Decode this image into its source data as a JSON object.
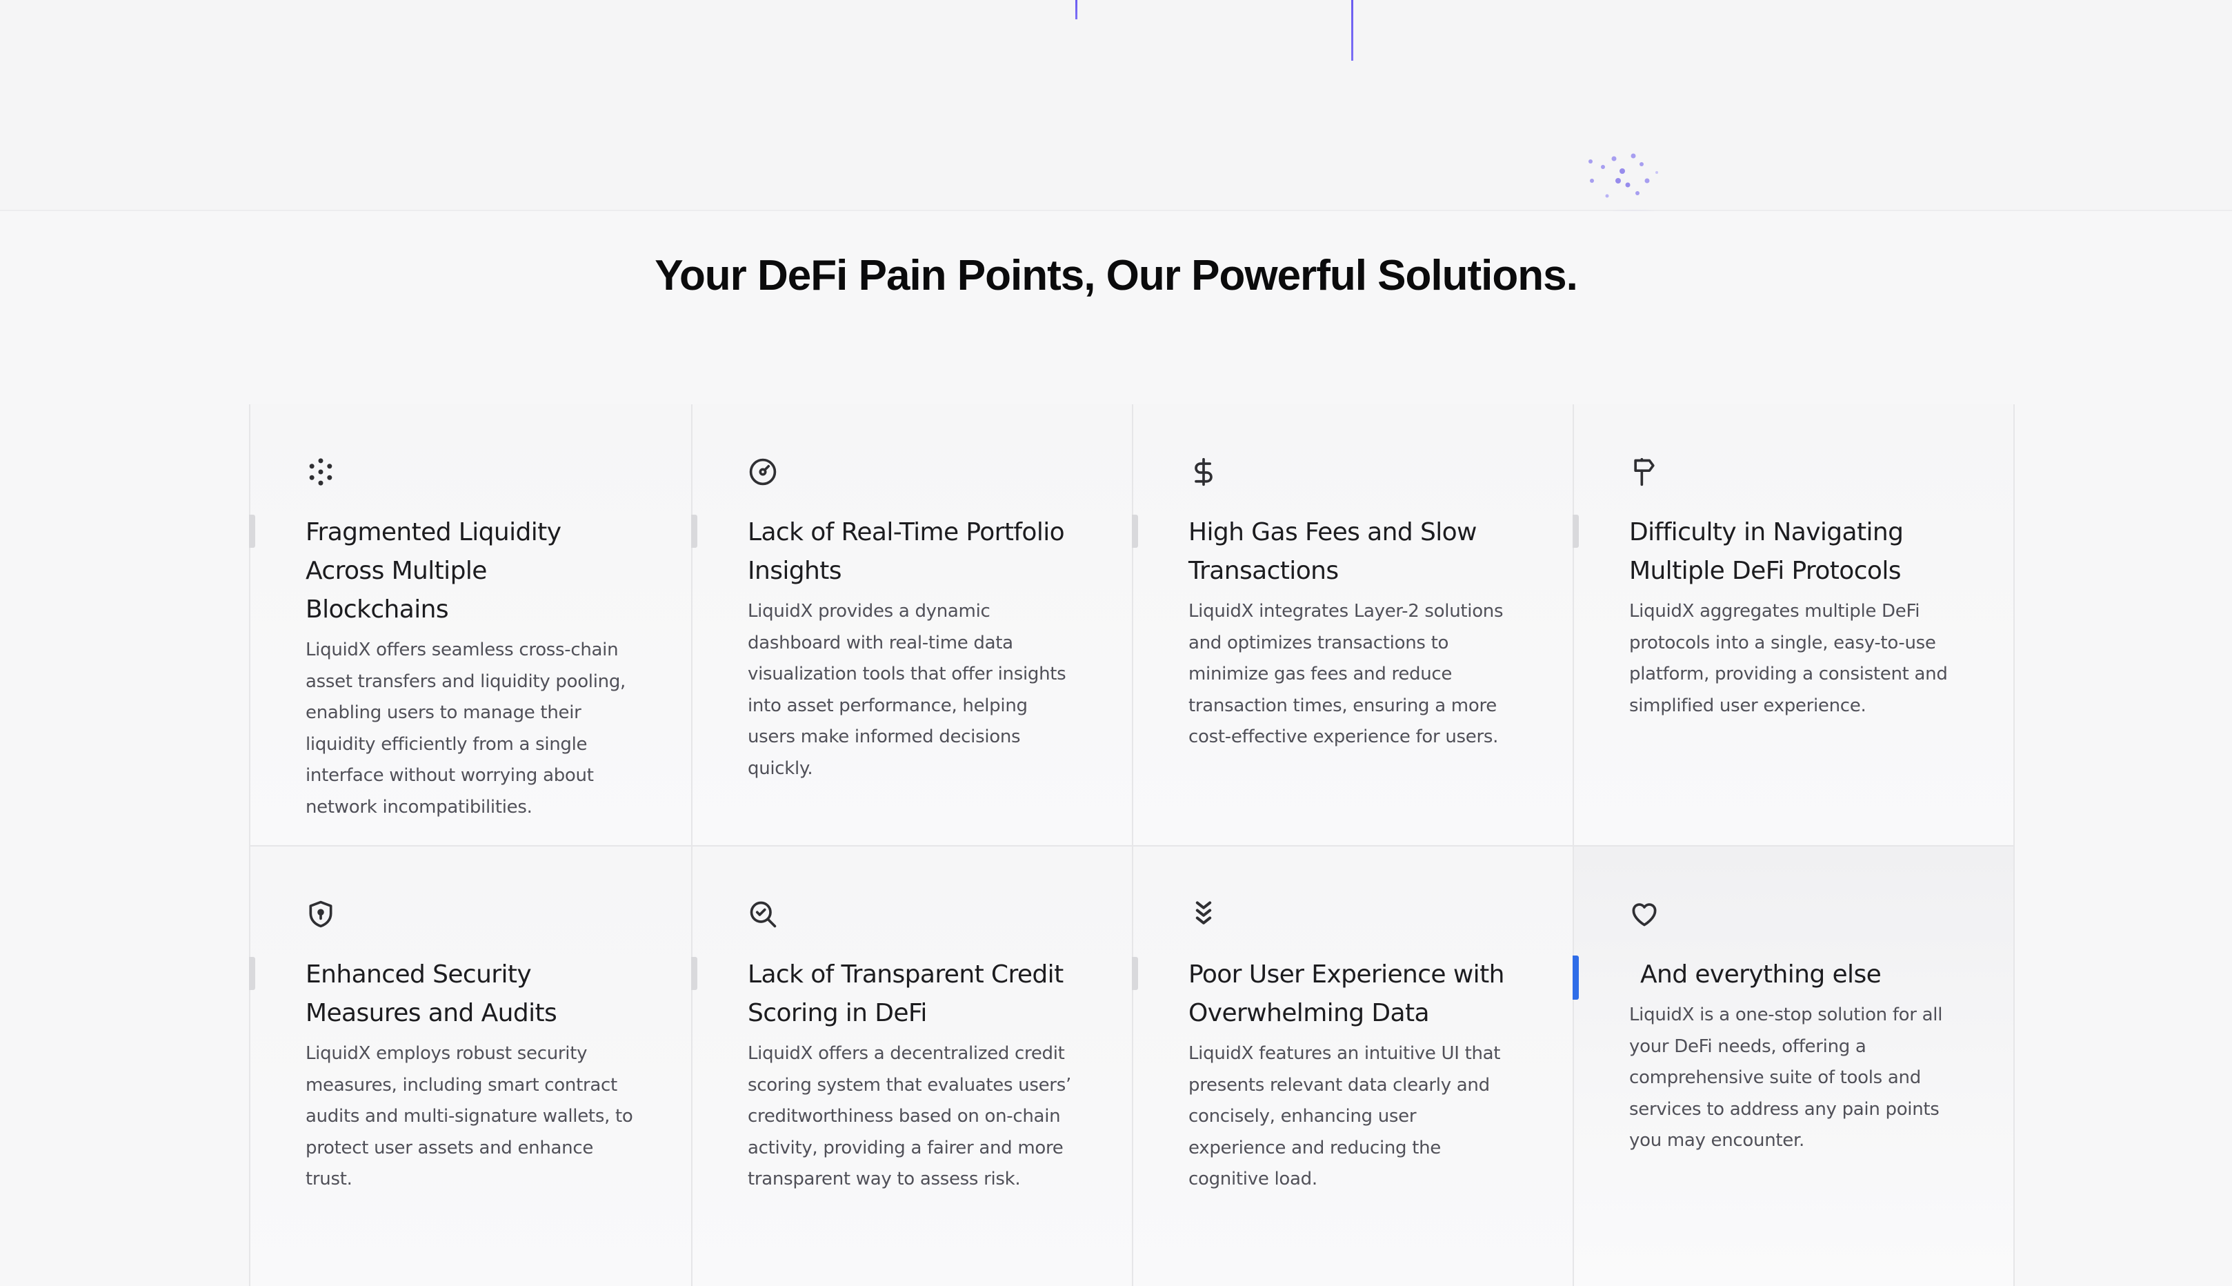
{
  "section": {
    "heading": "Your DeFi Pain Points, Our Powerful Solutions."
  },
  "cards": [
    {
      "icon": "dots-cluster-icon",
      "title": "Fragmented Liquidity Across Multiple Blockchains",
      "description": "LiquidX offers seamless cross-chain asset transfers and liquidity pooling, enabling users to manage their liquidity efficiently from a single interface without worrying about network incompatibilities."
    },
    {
      "icon": "gauge-icon",
      "title": "Lack of Real-Time Portfolio Insights",
      "description": "LiquidX provides a dynamic dashboard with real-time data visualization tools that offer insights into asset performance, helping users make informed decisions quickly."
    },
    {
      "icon": "dollar-icon",
      "title": "High Gas Fees and Slow Transactions",
      "description": "LiquidX integrates Layer-2 solutions and optimizes transactions to minimize gas fees and reduce transaction times, ensuring a more cost-effective experience for users."
    },
    {
      "icon": "signpost-icon",
      "title": "Difficulty in Navigating Multiple DeFi Protocols",
      "description": "LiquidX aggregates multiple DeFi protocols into a single, easy-to-use platform, providing a consistent and simplified user experience."
    },
    {
      "icon": "shield-lock-icon",
      "title": "Enhanced Security Measures and Audits",
      "description": "LiquidX employs robust security measures, including smart contract audits and multi-signature wallets, to protect user assets and enhance trust."
    },
    {
      "icon": "search-check-icon",
      "title": "Lack of Transparent Credit Scoring in DeFi",
      "description": "LiquidX offers a decentralized credit scoring system that evaluates users’ creditworthiness based on on-chain activity, providing a fairer and more transparent way to assess risk."
    },
    {
      "icon": "chevrons-down-icon",
      "title": "Poor User Experience with Overwhelming Data",
      "description": "LiquidX features an intuitive UI that presents relevant data clearly and concisely, enhancing user experience and reducing the cognitive load."
    },
    {
      "icon": "heart-icon",
      "title": "And everything else",
      "description": "LiquidX is a one-stop solution for all your DeFi needs, offering a comprehensive suite of tools and services to address any pain points you may encounter."
    }
  ],
  "colors": {
    "accent_active": "#2f6de8",
    "decor_purple": "#6b5cf0"
  }
}
